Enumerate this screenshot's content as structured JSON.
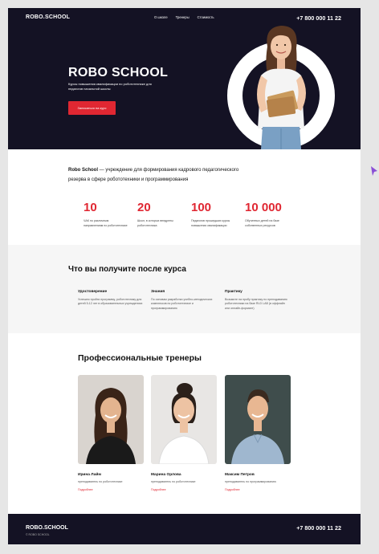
{
  "header": {
    "logo": "ROBO.SCHOOL",
    "nav": [
      "О школе",
      "Тренеры",
      "Стоимость"
    ],
    "phone": "+7 800 000 11 22"
  },
  "hero": {
    "title": "ROBO SCHOOL",
    "subtitle": "Курсы повышения квалификации по робототехнике для педагогов начальной школы",
    "button": "Записаться на курс"
  },
  "about": {
    "lead_bold": "Robo School",
    "lead_rest": " — учреждение для формирования кадрового педагогического резерва в сфере робототехники и программирования",
    "stats": [
      {
        "value": "10",
        "desc": "ЧАК по различным направлениям по робототехнике"
      },
      {
        "value": "20",
        "desc": "Школ, в которых внедрены робототехника"
      },
      {
        "value": "100",
        "desc": "Педагогов прошедших курсы повышения квалификации"
      },
      {
        "value": "10 000",
        "desc": "Обученных детей на базе собственных ресурсов"
      }
    ]
  },
  "benefits": {
    "title": "Что вы получите после курса",
    "items": [
      {
        "title": "Удостоверение",
        "desc": "Успешно пройти программу, робототехнику для детей 5-12 лет в образовательных учреждениях"
      },
      {
        "title": "Знания",
        "desc": "По основам разработки учебно-методических комплексов по робототехнике и программированию"
      },
      {
        "title": "Практику",
        "desc": "Возьмите на пробу практику по преподаванию робототехники на базе RLD LAB (в оффлайн или онлайн-формате)"
      }
    ]
  },
  "trainers": {
    "title": "Профессиональные тренеры",
    "items": [
      {
        "name": "Ирина Лайм",
        "role": "преподаватель по робототехнике",
        "link": "Подробнее"
      },
      {
        "name": "Марина Орлова",
        "role": "преподаватель по робототехнике",
        "link": "Подробнее"
      },
      {
        "name": "Максим Петров",
        "role": "преподаватель по программированию",
        "link": "Подробнее"
      }
    ]
  },
  "footer": {
    "logo": "ROBO.SCHOOL",
    "copyright": "© ROBO SCHOOL",
    "phone": "+7 800 000 11 22"
  },
  "colors": {
    "dark": "#141224",
    "accent": "#e02732",
    "light": "#f6f6f6"
  }
}
